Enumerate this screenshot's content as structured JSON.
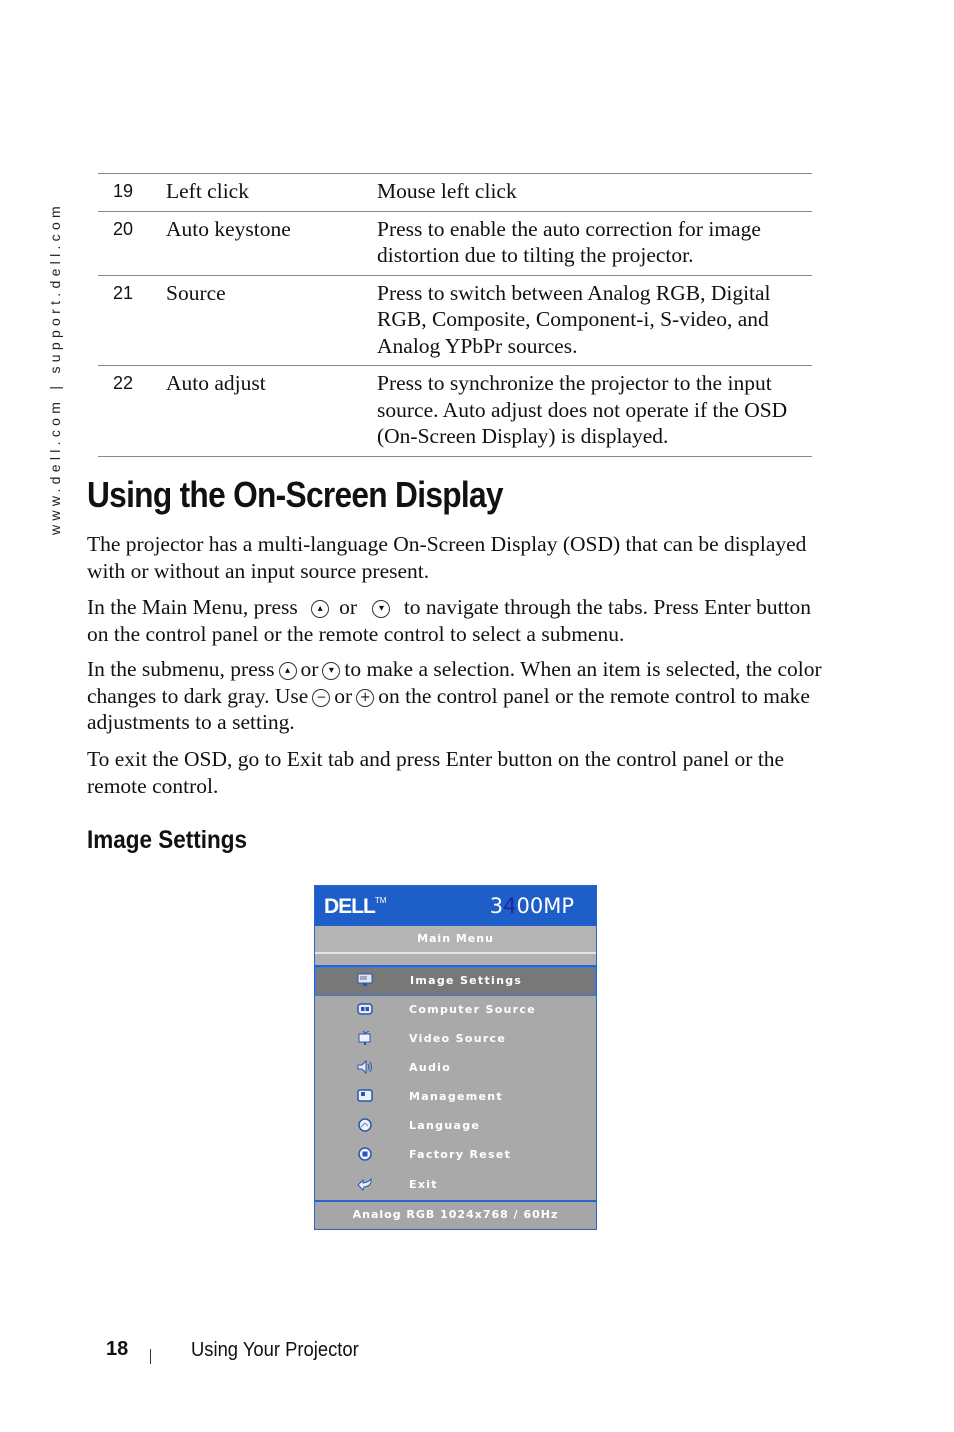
{
  "side_url": "www.dell.com | support.dell.com",
  "key_table": {
    "rows": [
      {
        "num": "19",
        "label": "Left click",
        "description": "Mouse left click"
      },
      {
        "num": "20",
        "label": "Auto keystone",
        "description": "Press to enable the auto correction for image distortion due to tilting the projector."
      },
      {
        "num": "21",
        "label": "Source",
        "description": "Press to switch between Analog RGB, Digital RGB, Composite, Component-i, S-video, and Analog YPbPr sources."
      },
      {
        "num": "22",
        "label": "Auto adjust",
        "description": "Press to synchronize the projector to the input source. Auto adjust does not operate if the OSD (On-Screen Display) is displayed."
      }
    ]
  },
  "section_title": "Using the On-Screen Display",
  "paragraphs": {
    "p1": "The projector has a multi-language On-Screen Display (OSD) that can be displayed with or without an input source present.",
    "p2a": "In the Main Menu, press",
    "p2b": "or",
    "p2c": "to navigate through the tabs. Press Enter button on the control panel or the remote control to select a submenu.",
    "p3a": "In the submenu, press",
    "p3b": "or",
    "p3c": "to make a selection. When an item is selected, the color changes to dark gray. Use",
    "p3d": "or",
    "p3e": "on the control panel or the remote control to make adjustments to a setting.",
    "p4": "To exit the OSD, go to Exit tab and press Enter button on the control panel or the remote control."
  },
  "icons": {
    "up": "up-button-icon",
    "down": "down-button-icon",
    "minus": "minus-button-icon",
    "plus": "plus-button-icon"
  },
  "subsection_title": "Image Settings",
  "osd": {
    "brand": "DELL",
    "trademark": "TM",
    "model_prefix": "3",
    "model_highlight": "4",
    "model_suffix": "00MP",
    "menu_title": "Main Menu",
    "items": [
      {
        "label": "Image Settings",
        "icon": "monitor-icon",
        "selected": true
      },
      {
        "label": "Computer Source",
        "icon": "computer-source-icon",
        "selected": false
      },
      {
        "label": "Video Source",
        "icon": "tv-icon",
        "selected": false
      },
      {
        "label": "Audio",
        "icon": "speaker-icon",
        "selected": false
      },
      {
        "label": "Management",
        "icon": "management-icon",
        "selected": false
      },
      {
        "label": "Language",
        "icon": "globe-icon",
        "selected": false
      },
      {
        "label": "Factory Reset",
        "icon": "reset-icon",
        "selected": false
      },
      {
        "label": "Exit",
        "icon": "exit-arrow-icon",
        "selected": false
      }
    ],
    "status": "Analog RGB 1024x768 / 60Hz",
    "colors": {
      "header": "#1e5ec8",
      "body": "#a9a9a9",
      "selected": "#787878",
      "border": "#2a63c9"
    }
  },
  "footer": {
    "page_number": "18",
    "chapter": "Using Your Projector"
  }
}
